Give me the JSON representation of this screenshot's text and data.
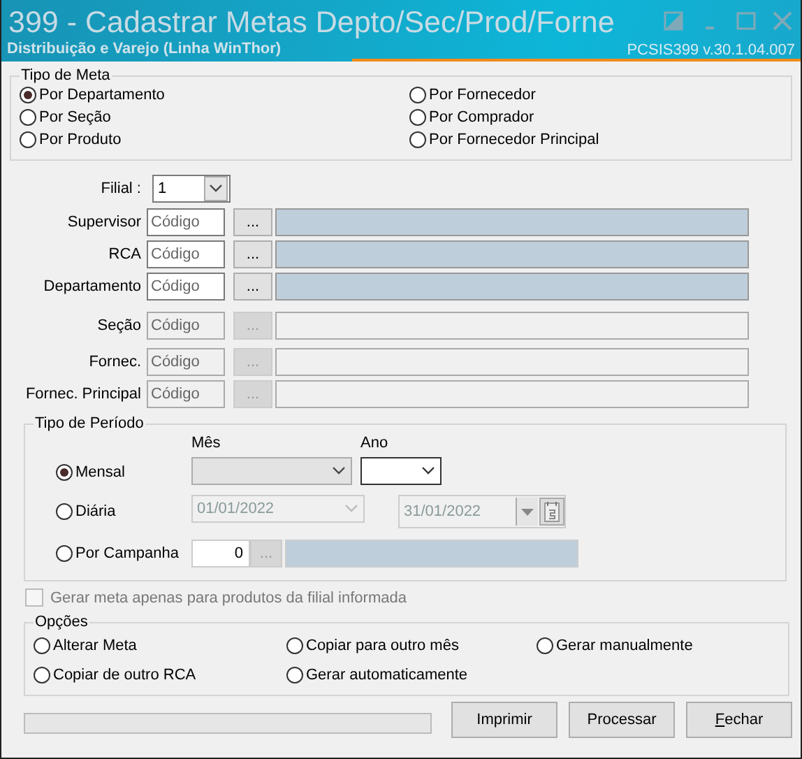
{
  "window": {
    "title": "399 - Cadastrar Metas Depto/Sec/Prod/Forne",
    "subtitle": "Distribuição e Varejo (Linha WinThor)",
    "version": "PCSIS399  v.30.1.04.007"
  },
  "tipo_de_meta": {
    "legend": "Tipo de Meta",
    "options": [
      {
        "label": "Por Departamento",
        "selected": true
      },
      {
        "label": "Por Seção",
        "selected": false
      },
      {
        "label": "Por Produto",
        "selected": false
      },
      {
        "label": "Por Fornecedor",
        "selected": false
      },
      {
        "label": "Por Comprador",
        "selected": false
      },
      {
        "label": "Por Fornecedor Principal",
        "selected": false
      }
    ]
  },
  "filial": {
    "label": "Filial :",
    "value": "1"
  },
  "fields": [
    {
      "label": "Supervisor",
      "placeholder": "Código",
      "button": "...",
      "enabled": true
    },
    {
      "label": "RCA",
      "placeholder": "Código",
      "button": "...",
      "enabled": true
    },
    {
      "label": "Departamento",
      "placeholder": "Código",
      "button": "...",
      "enabled": true
    },
    {
      "label": "Seção",
      "placeholder": "Código",
      "button": "...",
      "enabled": false
    },
    {
      "label": "Fornec.",
      "placeholder": "Código",
      "button": "...",
      "enabled": false
    },
    {
      "label": "Fornec. Principal",
      "placeholder": "Código",
      "button": "...",
      "enabled": false
    }
  ],
  "tipo_de_periodo": {
    "legend": "Tipo de Período",
    "month_label": "Mês",
    "year_label": "Ano",
    "options": [
      {
        "kind": "month",
        "label": "Mensal",
        "selected": true
      },
      {
        "kind": "daily",
        "label": "Diária",
        "selected": false,
        "start": "01/01/2022",
        "end": "31/01/2022"
      },
      {
        "kind": "campaign",
        "label": "Por Campanha",
        "selected": false,
        "value": "0",
        "button": "..."
      }
    ]
  },
  "filial_only": {
    "label": "Gerar meta apenas para produtos da filial informada",
    "checked": false,
    "disabled": true
  },
  "opcoes": {
    "legend": "Opções",
    "options": [
      {
        "label": "Alterar Meta",
        "selected": false
      },
      {
        "label": "Copiar de outro RCA",
        "selected": false
      },
      {
        "label": "Copiar para outro mês",
        "selected": false
      },
      {
        "label": "Gerar automaticamente",
        "selected": false
      },
      {
        "label": "Gerar manualmente",
        "selected": false
      }
    ]
  },
  "progress": {
    "level": 0
  },
  "buttons": [
    {
      "label": "Imprimir",
      "underline_first": false
    },
    {
      "label": "Processar",
      "underline_first": false
    },
    {
      "label": "Fechar",
      "underline_first": true
    }
  ]
}
